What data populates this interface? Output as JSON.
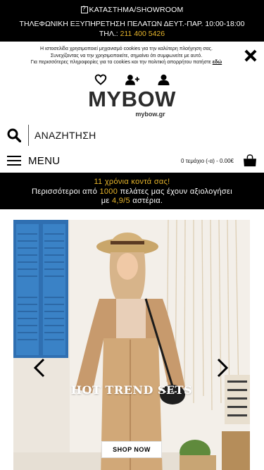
{
  "topbar": {
    "showroom": "ΚΑΤΑΣΤΗΜΑ/SHOWROOM",
    "hours": "ΤΗΛΕΦΩΝΙΚΗ ΕΞΥΠΗΡΕΤΗΣΗ ΠΕΛΑΤΩΝ ΔΕΥΤ.-ΠΑΡ. 10:00-18:00 ΤΗΛ.:",
    "phone": "211 400 5426"
  },
  "cookie": {
    "line1": "Η ιστοσελίδα χρησιμοποιεί μηχανισμό cookies για την καλύτερη πλοήγηση σας.",
    "line2": "Συνεχίζοντας να την χρησιμοποιείτε, σημαίνει ότι συμφωνείτε με αυτό.",
    "line3": "Για περισσότερες πληροφορίες για τα cookies και την πολιτική απορρήτου πατήστε",
    "link": "εδώ"
  },
  "header": {
    "brand": "MYBOW",
    "domain": "mybow.gr"
  },
  "search": {
    "label": "ΑΝΑΖΗΤΗΣΗ"
  },
  "menu": {
    "label": "MENU",
    "cart": "0 τεμάχιο (-α) - 0.00€"
  },
  "promo": {
    "line1": "11 χρόνια κοντά σας!",
    "line2_pre": "Περισσότεροι από ",
    "line2_num": "1000",
    "line2_post": " πελάτες μας έχουν αξιολογήσει",
    "line3_pre": "με ",
    "line3_rating": "4,9/5",
    "line3_post": " αστέρια."
  },
  "hero": {
    "title": "HOT TREND SETS",
    "cta": "SHOP NOW"
  },
  "colors": {
    "gold": "#e8b62c",
    "black": "#000000"
  }
}
